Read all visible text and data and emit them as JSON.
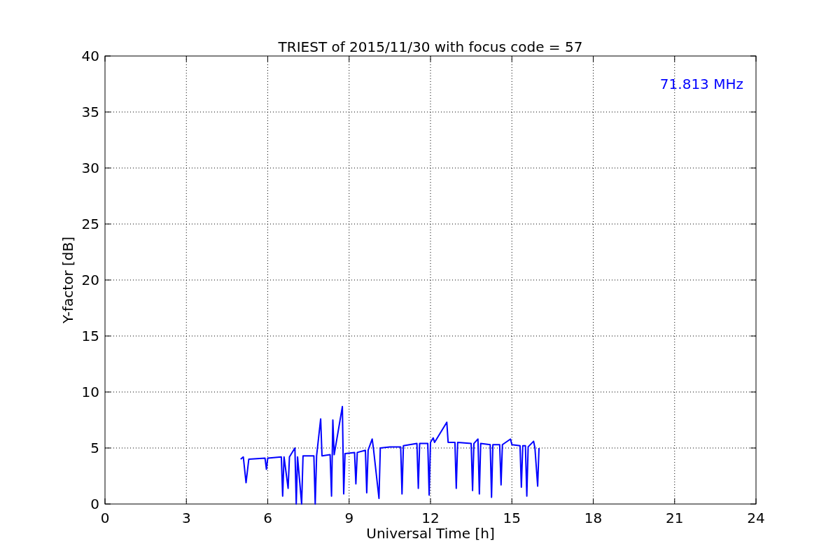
{
  "figure": {
    "chart_data": {
      "type": "line",
      "title": "TRIEST of 2015/11/30 with focus code = 57",
      "xlabel": "Universal Time [h]",
      "ylabel": "Y-factor [dB]",
      "x": [
        5.0,
        5.1,
        5.2,
        5.3,
        5.9,
        5.95,
        6.0,
        6.5,
        6.55,
        6.6,
        6.75,
        6.8,
        7.0,
        7.05,
        7.1,
        7.25,
        7.3,
        7.7,
        7.75,
        7.8,
        7.95,
        8.0,
        8.3,
        8.35,
        8.4,
        8.45,
        8.75,
        8.8,
        8.85,
        9.2,
        9.25,
        9.3,
        9.6,
        9.65,
        9.7,
        9.85,
        9.9,
        10.1,
        10.15,
        10.5,
        10.9,
        10.95,
        11.0,
        11.5,
        11.55,
        11.6,
        11.9,
        11.95,
        12.0,
        12.1,
        12.15,
        12.6,
        12.65,
        12.9,
        12.95,
        13.0,
        13.5,
        13.55,
        13.6,
        13.75,
        13.8,
        13.85,
        14.2,
        14.25,
        14.3,
        14.55,
        14.6,
        14.65,
        14.95,
        15.0,
        15.3,
        15.35,
        15.4,
        15.5,
        15.55,
        15.6,
        15.8,
        15.85,
        15.95,
        16.0
      ],
      "series": [
        {
          "name": "71.813 MHz",
          "color": "#0000ff",
          "values": [
            4.0,
            4.2,
            1.9,
            4.0,
            4.1,
            3.1,
            4.1,
            4.2,
            0.7,
            4.2,
            1.4,
            4.2,
            5.0,
            0.0,
            4.2,
            0.0,
            4.3,
            4.3,
            0.0,
            4.3,
            7.6,
            4.3,
            4.4,
            0.7,
            7.5,
            4.4,
            8.7,
            0.9,
            4.5,
            4.6,
            1.8,
            4.6,
            4.8,
            1.0,
            4.8,
            5.8,
            4.9,
            0.5,
            5.0,
            5.1,
            5.1,
            0.9,
            5.2,
            5.4,
            1.4,
            5.4,
            5.4,
            0.8,
            5.5,
            5.9,
            5.5,
            7.3,
            5.5,
            5.5,
            1.4,
            5.5,
            5.4,
            1.2,
            5.4,
            5.8,
            0.9,
            5.4,
            5.3,
            0.6,
            5.3,
            5.3,
            1.7,
            5.3,
            5.8,
            5.3,
            5.2,
            1.5,
            5.2,
            5.2,
            0.7,
            5.1,
            5.6,
            5.0,
            1.6,
            5.0
          ]
        }
      ],
      "xlim": [
        0,
        24
      ],
      "ylim": [
        0,
        40
      ],
      "xticks": [
        0,
        3,
        6,
        9,
        12,
        15,
        18,
        21,
        24
      ],
      "yticks": [
        0,
        5,
        10,
        15,
        20,
        25,
        30,
        35,
        40
      ],
      "grid": true
    }
  }
}
